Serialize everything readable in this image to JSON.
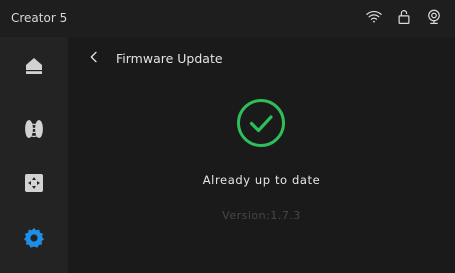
{
  "header": {
    "app_title": "Creator 5",
    "status_icons": [
      "wifi-icon",
      "lock-icon",
      "camera-icon"
    ]
  },
  "sidebar": {
    "items": [
      {
        "name": "home",
        "icon": "home-icon",
        "active": false
      },
      {
        "name": "filament",
        "icon": "filament-spool-icon",
        "active": false
      },
      {
        "name": "move",
        "icon": "move-controls-icon",
        "active": false
      },
      {
        "name": "settings",
        "icon": "gear-icon",
        "active": true
      }
    ]
  },
  "page": {
    "title": "Firmware Update",
    "back_icon": "chevron-left-icon",
    "status_icon": "check-circle-icon",
    "status_text": "Already up to date",
    "version_text": "Version:1.7.3"
  },
  "colors": {
    "accent_green": "#2fbf5a",
    "accent_blue": "#1e8fe6",
    "icon_gray": "#d2d2d2"
  }
}
